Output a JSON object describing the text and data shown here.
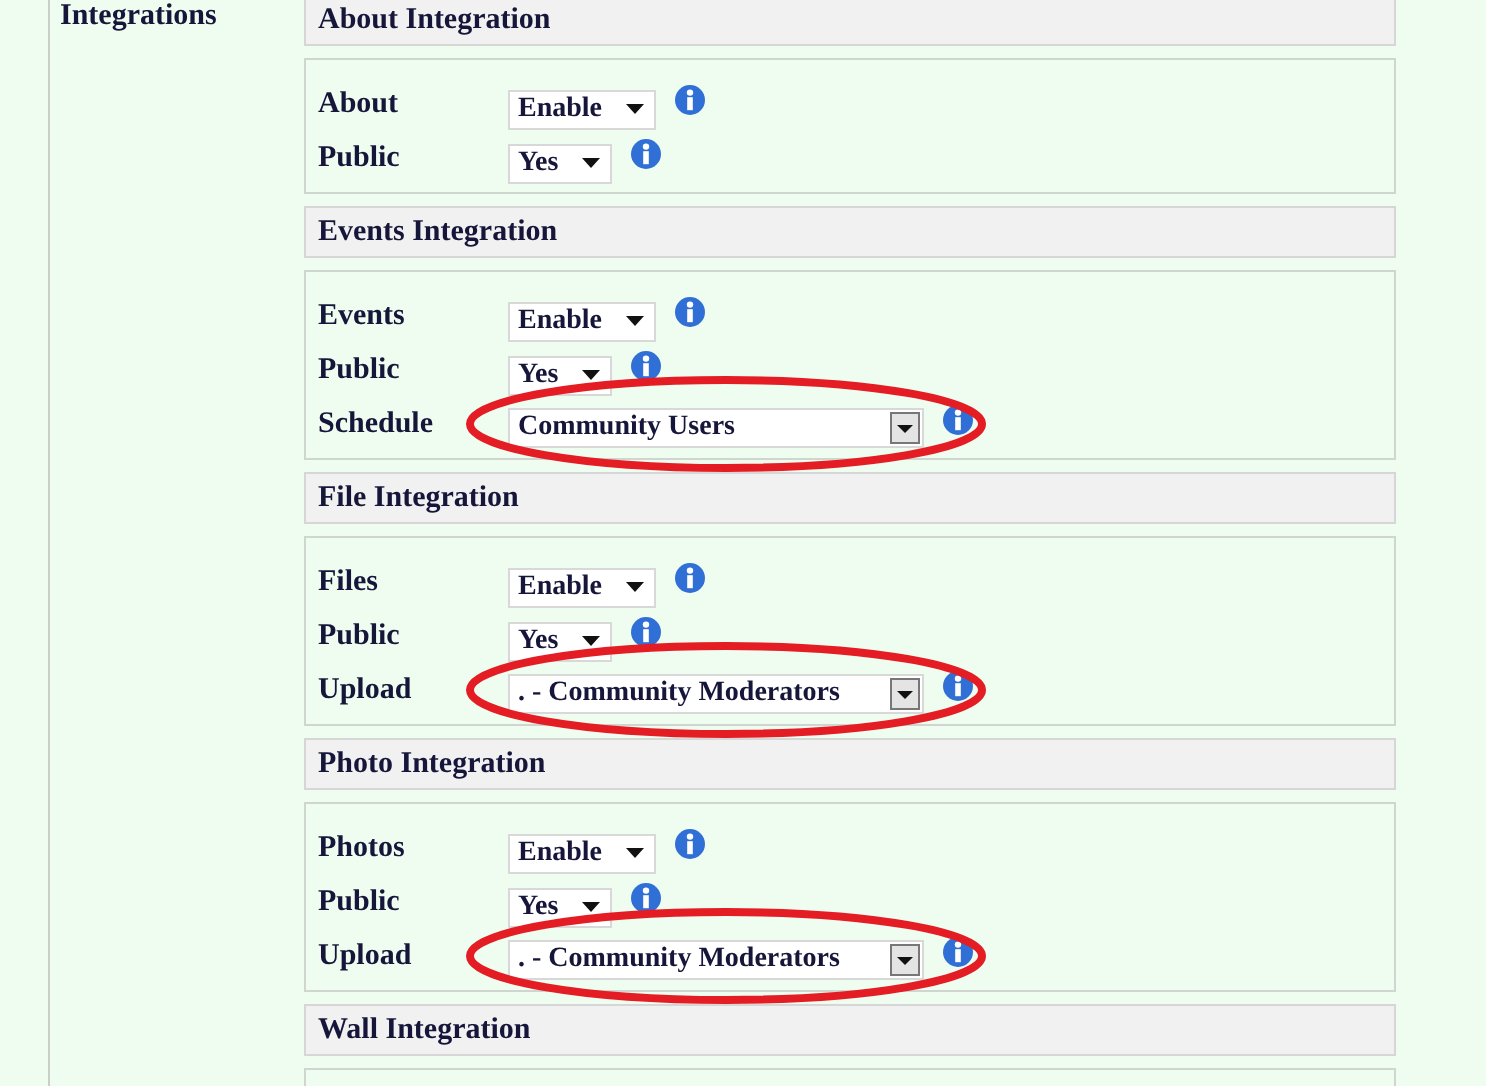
{
  "section_label": "Integrations",
  "groups": [
    {
      "title": "About Integration",
      "rows": [
        {
          "label": "About",
          "value": "Enable",
          "kind": "compact",
          "highlighted": false
        },
        {
          "label": "Public",
          "value": "Yes",
          "kind": "compact",
          "highlighted": false
        }
      ]
    },
    {
      "title": "Events Integration",
      "rows": [
        {
          "label": "Events",
          "value": "Enable",
          "kind": "compact",
          "highlighted": false
        },
        {
          "label": "Public",
          "value": "Yes",
          "kind": "compact",
          "highlighted": false
        },
        {
          "label": "Schedule",
          "value": "Community Users",
          "kind": "list",
          "highlighted": true
        }
      ]
    },
    {
      "title": "File Integration",
      "rows": [
        {
          "label": "Files",
          "value": "Enable",
          "kind": "compact",
          "highlighted": false
        },
        {
          "label": "Public",
          "value": "Yes",
          "kind": "compact",
          "highlighted": false
        },
        {
          "label": "Upload",
          "value": ". - Community Moderators",
          "kind": "list",
          "highlighted": true
        }
      ]
    },
    {
      "title": "Photo Integration",
      "rows": [
        {
          "label": "Photos",
          "value": "Enable",
          "kind": "compact",
          "highlighted": false
        },
        {
          "label": "Public",
          "value": "Yes",
          "kind": "compact",
          "highlighted": false
        },
        {
          "label": "Upload",
          "value": ". - Community Moderators",
          "kind": "list",
          "highlighted": true
        }
      ]
    },
    {
      "title": "Wall Integration"
    }
  ]
}
